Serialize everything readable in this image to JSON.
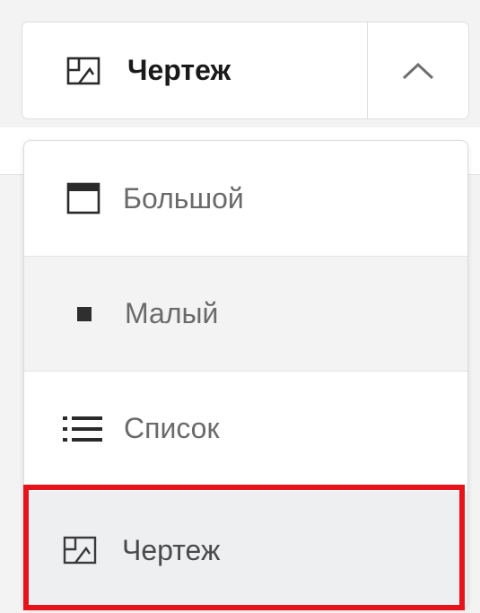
{
  "view_switcher": {
    "current_label": "Чертеж",
    "current_icon": "blueprint-icon",
    "chevron_icon": "chevron-up-icon"
  },
  "menu": {
    "items": [
      {
        "label": "Большой",
        "icon": "large-view-icon"
      },
      {
        "label": "Малый",
        "icon": "small-view-icon"
      },
      {
        "label": "Список",
        "icon": "list-view-icon"
      },
      {
        "label": "Чертеж",
        "icon": "blueprint-icon",
        "selected": true
      }
    ]
  },
  "colors": {
    "highlight": "#e8121b",
    "text_primary": "#1a1a1a",
    "text_secondary": "#6a6a6a"
  }
}
